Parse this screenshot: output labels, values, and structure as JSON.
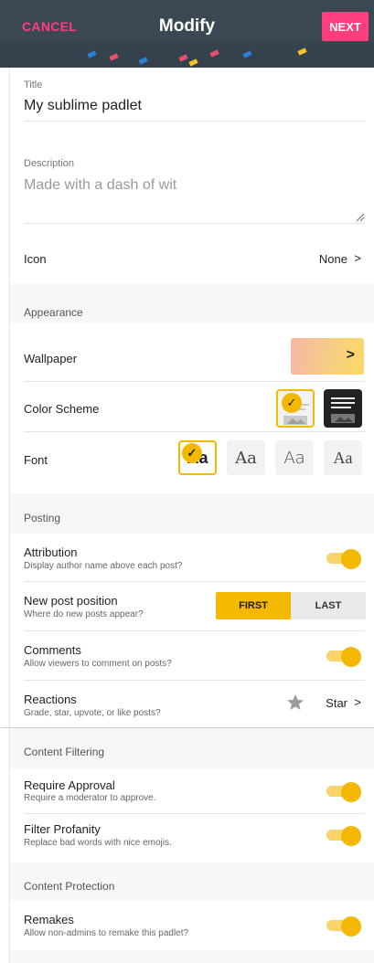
{
  "header": {
    "cancel_label": "CANCEL",
    "title": "Modify",
    "next_label": "NEXT",
    "accent_color": "#ff3d7f"
  },
  "details": {
    "title_label": "Title",
    "title_value": "My sublime padlet",
    "description_label": "Description",
    "description_placeholder": "Made with a dash of wit",
    "icon_label": "Icon",
    "icon_value": "None",
    "chevron": ">"
  },
  "appearance": {
    "section_label": "Appearance",
    "wallpaper_label": "Wallpaper",
    "wallpaper_arrow": ">",
    "color_scheme_label": "Color Scheme",
    "font_label": "Font",
    "font_samples": [
      "Aa",
      "Aa",
      "Aa",
      "Aa"
    ],
    "check_glyph": "✓",
    "selected_color": "#f5b800"
  },
  "posting": {
    "section_label": "Posting",
    "attribution_label": "Attribution",
    "attribution_sub": "Display author name above each post?",
    "new_post_label": "New post position",
    "new_post_sub": "Where do new posts appear?",
    "position_options": [
      "FIRST",
      "LAST"
    ],
    "position_selected": "FIRST",
    "comments_label": "Comments",
    "comments_sub": "Allow viewers to comment on posts?",
    "reactions_label": "Reactions",
    "reactions_sub": "Grade, star, upvote, or like posts?",
    "reactions_value": "Star",
    "reactions_icon": "star-icon"
  },
  "filtering": {
    "section_label": "Content Filtering",
    "approval_label": "Require Approval",
    "approval_sub": "Require a moderator to approve.",
    "profanity_label": "Filter Profanity",
    "profanity_sub": "Replace bad words with nice emojis."
  },
  "protection": {
    "section_label": "Content Protection",
    "remakes_label": "Remakes",
    "remakes_sub": "Allow non-admins to remake this padlet?"
  }
}
